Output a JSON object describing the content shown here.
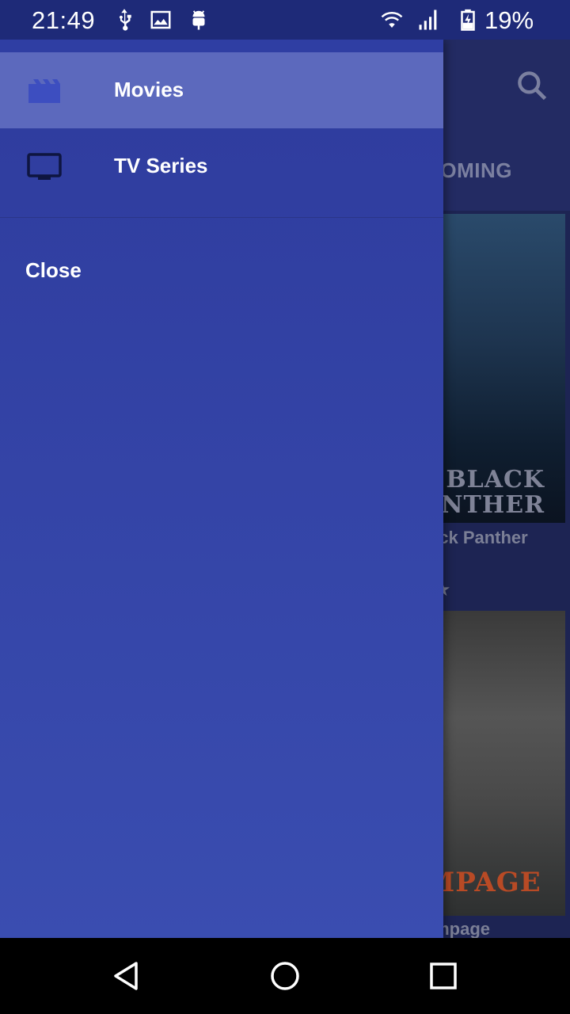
{
  "status_bar": {
    "time": "21:49",
    "battery_percent": "19%",
    "icons": [
      "usb-icon",
      "image-icon",
      "android-icon",
      "wifi-icon",
      "signal-icon",
      "battery-icon"
    ]
  },
  "background_app": {
    "tab_label": "UPCOMING",
    "movies": [
      {
        "title": "Black Panther",
        "poster_text": "BLACK PANTHER"
      },
      {
        "title": "Rampage",
        "poster_text": "RAMPAGE"
      }
    ],
    "rating_icon": "star-icon"
  },
  "drawer": {
    "items": [
      {
        "label": "Movies",
        "icon": "movie-clapper-icon",
        "selected": true
      },
      {
        "label": "TV Series",
        "icon": "tv-icon",
        "selected": false
      }
    ],
    "close_label": "Close"
  },
  "nav_bar": {
    "buttons": [
      "back-icon",
      "home-icon",
      "recents-icon"
    ]
  },
  "colors": {
    "drawer": "#2e3b9d",
    "drawer_selected": "#5c69bd",
    "status_bar": "#1e2a78",
    "toolbar": "#232b63"
  }
}
